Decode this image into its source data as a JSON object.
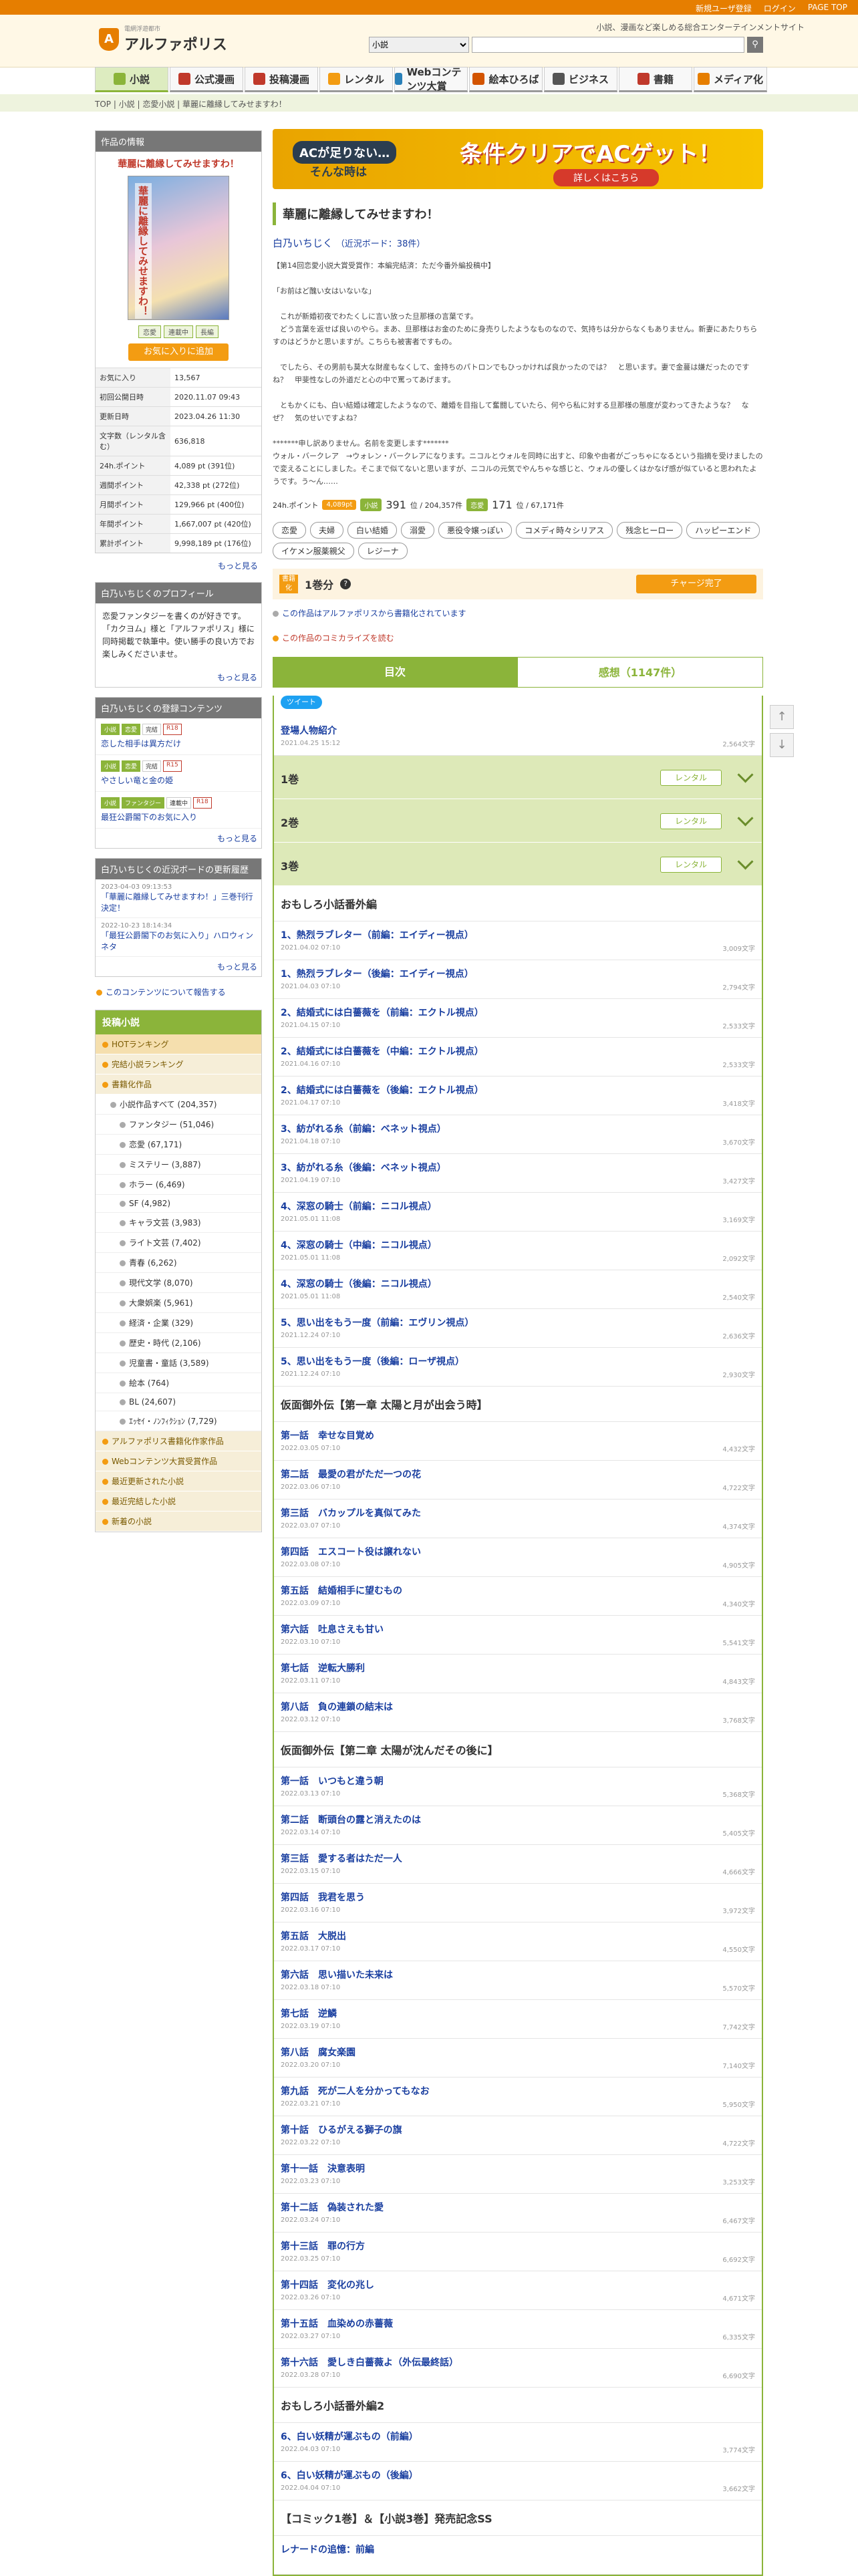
{
  "topbar": {
    "register": "新規ユーザ登録",
    "login": "ログイン",
    "pagetop": "PAGE TOP"
  },
  "header": {
    "logo": "アルファポリス",
    "logo_sub": "電網浮遊都市",
    "tagline": "小説、漫画など楽しめる総合エンターテインメントサイト",
    "search_select": "小説",
    "search_icon": "search-icon"
  },
  "nav": [
    {
      "label": "小説",
      "color": "#8bb43a"
    },
    {
      "label": "公式漫画",
      "color": "#c0392b"
    },
    {
      "label": "投稿漫画",
      "color": "#c0392b"
    },
    {
      "label": "レンタル",
      "color": "#f39c12"
    },
    {
      "label": "Webコンテンツ大賞",
      "color": "#2980b9"
    },
    {
      "label": "絵本ひろば",
      "color": "#d35400"
    },
    {
      "label": "ビジネス",
      "color": "#555555"
    },
    {
      "label": "書籍",
      "color": "#c0392b"
    },
    {
      "label": "メディア化",
      "color": "#e67e00"
    }
  ],
  "breadcrumb": "TOP | 小説 | 恋愛小説 | 華麗に離縁してみせますわ！",
  "sidebar": {
    "info_heading": "作品の情報",
    "work_title": "華麗に離縁してみせますわ！",
    "tags": [
      "恋愛",
      "連載中",
      "長編"
    ],
    "fav_button": "お気に入りに追加",
    "stats": [
      {
        "k": "お気に入り",
        "v": "13,567"
      },
      {
        "k": "初回公開日時",
        "v": "2020.11.07 09:43"
      },
      {
        "k": "更新日時",
        "v": "2023.04.26 11:30"
      },
      {
        "k": "文字数（レンタル含む）",
        "v": "636,818"
      },
      {
        "k": "24h.ポイント",
        "v": "4,089 pt (391位)"
      },
      {
        "k": "週間ポイント",
        "v": "42,338 pt (272位)"
      },
      {
        "k": "月間ポイント",
        "v": "129,966 pt (400位)"
      },
      {
        "k": "年間ポイント",
        "v": "1,667,007 pt (420位)"
      },
      {
        "k": "累計ポイント",
        "v": "9,998,189 pt (176位)"
      }
    ],
    "more": "もっと見る",
    "profile_heading": "白乃いちじくのプロフィール",
    "profile_text": "恋愛ファンタジーを書くのが好きです。「カクヨム」様と「アルファポリス」様に同時掲載で執筆中。使い勝手の良い方でお楽しみくださいませ。",
    "contents_heading": "白乃いちじくの登録コンテンツ",
    "contents": [
      {
        "tags": [
          "小説",
          "恋愛",
          "完結",
          "R18"
        ],
        "title": "恋した相手は異方だけ"
      },
      {
        "tags": [
          "小説",
          "恋愛",
          "完結",
          "R15"
        ],
        "title": "やさしい竜と金の姫"
      },
      {
        "tags": [
          "小説",
          "ファンタジー",
          "連載中",
          "R18"
        ],
        "title": "最狂公爵閣下のお気に入り"
      }
    ],
    "board_heading": "白乃いちじくの近況ボードの更新履歴",
    "board": [
      {
        "date": "2023-04-03 09:13:53",
        "title": "「華麗に離縁してみせますわ！」三巻刊行決定！"
      },
      {
        "date": "2022-10-23 18:14:34",
        "title": "「最狂公爵閣下のお気に入り」ハロウィンネタ"
      }
    ],
    "report": "このコンテンツについて報告する",
    "ranking_heading": "投稿小説",
    "ranking_top": [
      "HOTランキング",
      "完結小説ランキング",
      "書籍化作品"
    ],
    "ranking_all": "小説作品すべて (204,357)",
    "ranking_genres": [
      "ファンタジー (51,046)",
      "恋愛 (67,171)",
      "ミステリー (3,887)",
      "ホラー (6,469)",
      "SF (4,982)",
      "キャラ文芸 (3,983)",
      "ライト文芸 (7,402)",
      "青春 (6,262)",
      "現代文学 (8,070)",
      "大衆娯楽 (5,961)",
      "経済・企業 (329)",
      "歴史・時代 (2,106)",
      "児童書・童話 (3,589)",
      "絵本 (764)",
      "BL (24,607)",
      "ｴｯｾｲ・ﾉﾝﾌｨｸｼｮﾝ (7,729)"
    ],
    "ranking_bottom": [
      "アルファポリス書籍化作家作品",
      "Webコンテンツ大賞受賞作品",
      "最近更新された小説",
      "最近完結した小説",
      "新着の小説"
    ]
  },
  "main": {
    "banner": {
      "line1": "ACが足りない…",
      "line2": "そんな時は",
      "big": "条件クリアでACゲット！",
      "cta": "詳しくはこちら"
    },
    "title": "華麗に離縁してみせますわ！",
    "author": "白乃いちじく",
    "author_board": "（近況ボード：38件）",
    "description": "【第14回恋愛小説大賞受賞作：本編完結済：ただ今番外編投稿中】\n\n「お前はど醜い女はいないな」\n\n　これが新婚初夜でわたくしに言い放った旦那様の言葉です。\n　どう言葉を返せば良いのやら。まあ、旦那様はお金のために身売りしたようなものなので、気持ちは分からなくもありません。新妻にあたりちらすのはどうかと思いますが。こちらも被害者ですもの。\n\n　でしたら、その男前も莫大な財産もなくして、金持ちのパトロンでもひっかければ良かったのでは？　と思います。妻で金蔓は嫌だったのですね？　甲斐性なしの外道だと心の中で罵ってあげます。\n\n　ともかくにも、白い結婚は確定したようなので、離婚を目指して奮闘していたら、何やら私に対する旦那様の態度が変わってきたような？　なぜ？　気のせいですよね？\n\n*******申し訳ありません。名前を変更します*******\nウォル・バークレア　→ウォレン・バークレアになります。ニコルとウォルを同時に出すと、印象や由者がごっちゃになるという指摘を受けましたので変えることにしました。そこまで似てないと思いますが、ニコルの元気でやんちゃな感じと、ウォルの優しくはかなげ感が似ていると思われたようです。う〜ん……",
    "points_label": "24h.ポイント",
    "points_pill": "4,089pt",
    "novel_pill": "小説",
    "novel_rank": "391",
    "novel_total": "位 / 204,357件",
    "genre_pill": "恋愛",
    "genre_rank": "171",
    "genre_total": "位 / 67,171件",
    "tags": [
      "恋愛",
      "夫婦",
      "白い結婚",
      "溺愛",
      "悪役令嬢っぽい",
      "コメディ時々シリアス",
      "残念ヒーロー",
      "ハッピーエンド",
      "イケメン服薬親父",
      "レジーナ"
    ],
    "volume_badge": "書籍化",
    "volume_title": "1巻分",
    "charge_button": "チャージ完了",
    "note_books": "この作品はアルファポリスから書籍化されています",
    "note_comic": "この作品のコミカライズを読む",
    "tab_toc": "目次",
    "tab_reviews": "感想（1147件）",
    "tweet": "ツイート",
    "toc": [
      {
        "type": "ep",
        "title": "登場人物紹介",
        "date": "2021.04.25 15:12",
        "chars": "2,564文字"
      },
      {
        "type": "vol",
        "title": "1巻",
        "rent": "レンタル"
      },
      {
        "type": "vol",
        "title": "2巻",
        "rent": "レンタル"
      },
      {
        "type": "vol",
        "title": "3巻",
        "rent": "レンタル"
      },
      {
        "type": "sec",
        "title": "おもしろ小話番外編"
      },
      {
        "type": "ep",
        "title": "1、熱烈ラブレター（前編：エイディー視点）",
        "date": "2021.04.02 07:10",
        "chars": "3,009文字"
      },
      {
        "type": "ep",
        "title": "1、熱烈ラブレター（後編：エイディー視点）",
        "date": "2021.04.03 07:10",
        "chars": "2,794文字"
      },
      {
        "type": "ep",
        "title": "2、結婚式には白薔薇を（前編：エクトル視点）",
        "date": "2021.04.15 07:10",
        "chars": "2,533文字"
      },
      {
        "type": "ep",
        "title": "2、結婚式には白薔薇を（中編：エクトル視点）",
        "date": "2021.04.16 07:10",
        "chars": "2,533文字"
      },
      {
        "type": "ep",
        "title": "2、結婚式には白薔薇を（後編：エクトル視点）",
        "date": "2021.04.17 07:10",
        "chars": "3,418文字"
      },
      {
        "type": "ep",
        "title": "3、紡がれる糸（前編：ベネット視点）",
        "date": "2021.04.18 07:10",
        "chars": "3,670文字"
      },
      {
        "type": "ep",
        "title": "3、紡がれる糸（後編：ベネット視点）",
        "date": "2021.04.19 07:10",
        "chars": "3,427文字"
      },
      {
        "type": "ep",
        "title": "4、深窓の騎士（前編：ニコル視点）",
        "date": "2021.05.01 11:08",
        "chars": "3,169文字"
      },
      {
        "type": "ep",
        "title": "4、深窓の騎士（中編：ニコル視点）",
        "date": "2021.05.01 11:08",
        "chars": "2,092文字"
      },
      {
        "type": "ep",
        "title": "4、深窓の騎士（後編：ニコル視点）",
        "date": "2021.05.01 11:08",
        "chars": "2,540文字"
      },
      {
        "type": "ep",
        "title": "5、思い出をもう一度（前編：エヴリン視点）",
        "date": "2021.12.24 07:10",
        "chars": "2,636文字"
      },
      {
        "type": "ep",
        "title": "5、思い出をもう一度（後編：ローザ視点）",
        "date": "2021.12.24 07:10",
        "chars": "2,930文字"
      },
      {
        "type": "sec",
        "title": "仮面御外伝【第一章 太陽と月が出会う時】"
      },
      {
        "type": "ep",
        "title": "第一話　幸せな目覚め",
        "date": "2022.03.05 07:10",
        "chars": "4,432文字"
      },
      {
        "type": "ep",
        "title": "第二話　最愛の君がただ一つの花",
        "date": "2022.03.06 07:10",
        "chars": "4,722文字"
      },
      {
        "type": "ep",
        "title": "第三話　バカップルを真似てみた",
        "date": "2022.03.07 07:10",
        "chars": "4,374文字"
      },
      {
        "type": "ep",
        "title": "第四話　エスコート役は譲れない",
        "date": "2022.03.08 07:10",
        "chars": "4,905文字"
      },
      {
        "type": "ep",
        "title": "第五話　結婚相手に望むもの",
        "date": "2022.03.09 07:10",
        "chars": "4,340文字"
      },
      {
        "type": "ep",
        "title": "第六話　吐息さえも甘い",
        "date": "2022.03.10 07:10",
        "chars": "5,541文字"
      },
      {
        "type": "ep",
        "title": "第七話　逆転大勝利",
        "date": "2022.03.11 07:10",
        "chars": "4,843文字"
      },
      {
        "type": "ep",
        "title": "第八話　負の連鎖の結末は",
        "date": "2022.03.12 07:10",
        "chars": "3,768文字"
      },
      {
        "type": "sec",
        "title": "仮面御外伝【第二章 太陽が沈んだその後に】"
      },
      {
        "type": "ep",
        "title": "第一話　いつもと違う朝",
        "date": "2022.03.13 07:10",
        "chars": "5,368文字"
      },
      {
        "type": "ep",
        "title": "第二話　断頭台の露と消えたのは",
        "date": "2022.03.14 07:10",
        "chars": "5,405文字"
      },
      {
        "type": "ep",
        "title": "第三話　愛する者はただ一人",
        "date": "2022.03.15 07:10",
        "chars": "4,666文字"
      },
      {
        "type": "ep",
        "title": "第四話　我君を思う",
        "date": "2022.03.16 07:10",
        "chars": "3,972文字"
      },
      {
        "type": "ep",
        "title": "第五話　大脱出",
        "date": "2022.03.17 07:10",
        "chars": "4,550文字"
      },
      {
        "type": "ep",
        "title": "第六話　思い描いた未来は",
        "date": "2022.03.18 07:10",
        "chars": "5,570文字"
      },
      {
        "type": "ep",
        "title": "第七話　逆鱗",
        "date": "2022.03.19 07:10",
        "chars": "7,742文字"
      },
      {
        "type": "ep",
        "title": "第八話　腐女楽園",
        "date": "2022.03.20 07:10",
        "chars": "7,140文字"
      },
      {
        "type": "ep",
        "title": "第九話　死が二人を分かってもなお",
        "date": "2022.03.21 07:10",
        "chars": "5,950文字"
      },
      {
        "type": "ep",
        "title": "第十話　ひるがえる獅子の旗",
        "date": "2022.03.22 07:10",
        "chars": "4,722文字"
      },
      {
        "type": "ep",
        "title": "第十一話　決意表明",
        "date": "2022.03.23 07:10",
        "chars": "3,253文字"
      },
      {
        "type": "ep",
        "title": "第十二話　偽装された愛",
        "date": "2022.03.24 07:10",
        "chars": "6,467文字"
      },
      {
        "type": "ep",
        "title": "第十三話　罪の行方",
        "date": "2022.03.25 07:10",
        "chars": "6,692文字"
      },
      {
        "type": "ep",
        "title": "第十四話　変化の兆し",
        "date": "2022.03.26 07:10",
        "chars": "4,671文字"
      },
      {
        "type": "ep",
        "title": "第十五話　血染めの赤薔薇",
        "date": "2022.03.27 07:10",
        "chars": "6,335文字"
      },
      {
        "type": "ep",
        "title": "第十六話　愛しき白薔薇よ（外伝最終話）",
        "date": "2022.03.28 07:10",
        "chars": "6,690文字"
      },
      {
        "type": "sec",
        "title": "おもしろ小話番外編2"
      },
      {
        "type": "ep",
        "title": "6、白い妖精が運ぶもの（前編）",
        "date": "2022.04.03 07:10",
        "chars": "3,774文字"
      },
      {
        "type": "ep",
        "title": "6、白い妖精が運ぶもの（後編）",
        "date": "2022.04.04 07:10",
        "chars": "3,662文字"
      },
      {
        "type": "sec",
        "title": "【コミック1巻】＆【小説3巻】発売記念SS"
      },
      {
        "type": "ep",
        "title": "レナードの追憶：前編",
        "date": "",
        "chars": ""
      }
    ]
  },
  "colors": {
    "accent": "#8bb43a",
    "brand": "#e67e00",
    "link": "#1a3fa0"
  }
}
